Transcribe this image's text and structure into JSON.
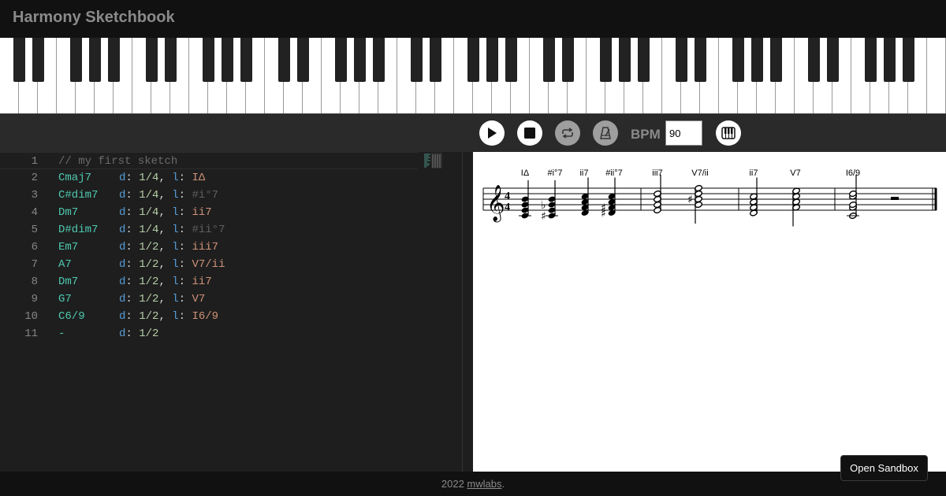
{
  "app": {
    "title": "Harmony Sketchbook"
  },
  "toolbar": {
    "play_icon": "play-icon",
    "stop_icon": "stop-icon",
    "loop_icon": "loop-icon",
    "metronome_icon": "metronome-icon",
    "bpm_label": "BPM",
    "bpm_value": "90",
    "keyboard_icon": "piano-keyboard-icon"
  },
  "editor": {
    "lines": [
      {
        "n": "1",
        "comment": "// my first sketch"
      },
      {
        "n": "2",
        "chord": "Cmaj7",
        "d": "1/4",
        "l": "IΔ"
      },
      {
        "n": "3",
        "chord": "C#dim7",
        "d": "1/4",
        "l": "#i°7"
      },
      {
        "n": "4",
        "chord": "Dm7",
        "d": "1/4",
        "l": "ii7"
      },
      {
        "n": "5",
        "chord": "D#dim7",
        "d": "1/4",
        "l": "#ii°7"
      },
      {
        "n": "6",
        "chord": "Em7",
        "d": "1/2",
        "l": "iii7"
      },
      {
        "n": "7",
        "chord": "A7",
        "d": "1/2",
        "l": "V7/ii"
      },
      {
        "n": "8",
        "chord": "Dm7",
        "d": "1/2",
        "l": "ii7"
      },
      {
        "n": "9",
        "chord": "G7",
        "d": "1/2",
        "l": "V7"
      },
      {
        "n": "10",
        "chord": "C6/9",
        "d": "1/2",
        "l": "I6/9"
      },
      {
        "n": "11",
        "chord": "-",
        "d": "1/2"
      }
    ],
    "key_d": "d",
    "key_l": "l"
  },
  "score": {
    "time_signature": [
      "4",
      "4"
    ],
    "chord_labels": [
      "IΔ",
      "#i°7",
      "ii7",
      "#ii°7",
      "iii7",
      "V7/ii",
      "ii7",
      "V7",
      "I6/9"
    ]
  },
  "footer": {
    "year": "2022",
    "link": "mwlabs",
    "period": "."
  },
  "sandbox_button": "Open Sandbox",
  "colors": {
    "chord": "#4ec9b0",
    "keyword": "#569cd6",
    "number": "#b5cea8",
    "label": "#ce9178",
    "dim_label": "#5f5f5f"
  }
}
